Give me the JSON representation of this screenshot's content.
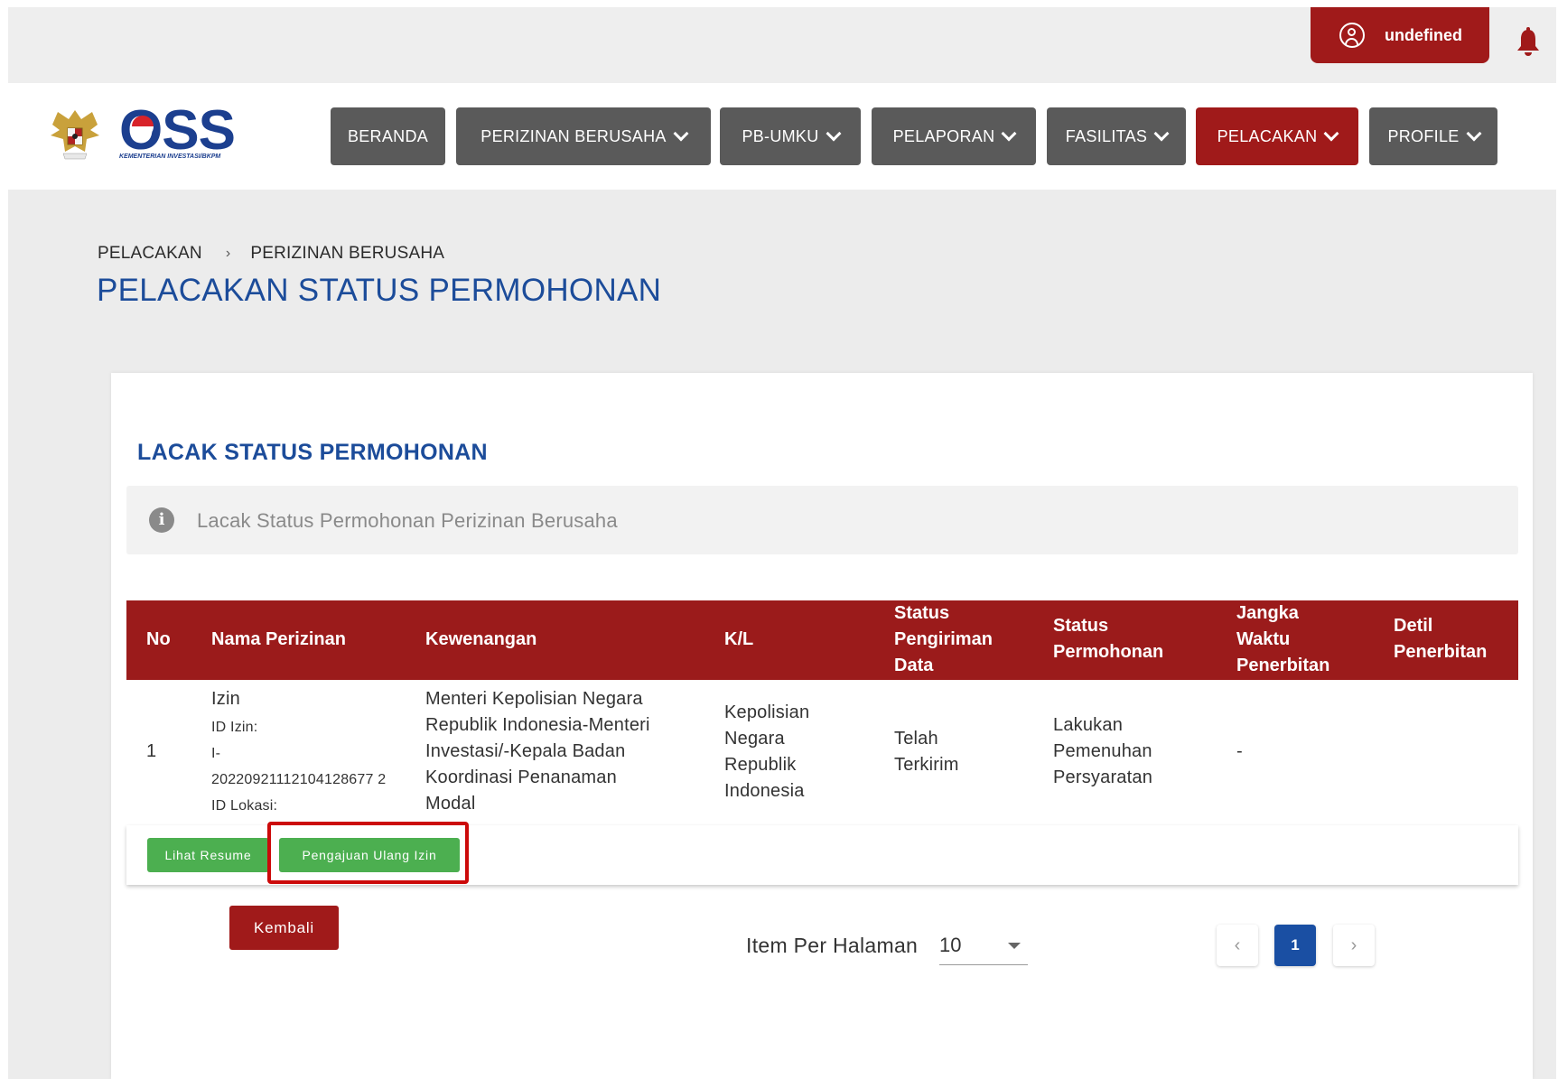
{
  "user": {
    "name": "undefined"
  },
  "brand": {
    "logo_text": "OSS",
    "logo_subtitle": "KEMENTERIAN INVESTASI/BKPM"
  },
  "nav": {
    "items": [
      {
        "label": "BERANDA",
        "dropdown": false,
        "active": false
      },
      {
        "label": "PERIZINAN BERUSAHA",
        "dropdown": true,
        "active": false
      },
      {
        "label": "PB-UMKU",
        "dropdown": true,
        "active": false
      },
      {
        "label": "PELAPORAN",
        "dropdown": true,
        "active": false
      },
      {
        "label": "FASILITAS",
        "dropdown": true,
        "active": false
      },
      {
        "label": "PELACAKAN",
        "dropdown": true,
        "active": true
      },
      {
        "label": "PROFILE",
        "dropdown": true,
        "active": false
      }
    ]
  },
  "breadcrumb": {
    "items": [
      "PELACAKAN",
      "PERIZINAN BERUSAHA"
    ],
    "separator": "›"
  },
  "page": {
    "title": "PELACAKAN STATUS PERMOHONAN"
  },
  "card": {
    "title": "LACAK STATUS PERMOHONAN",
    "info": {
      "icon": "info-icon",
      "text": "Lacak Status Permohonan Perizinan Berusaha"
    }
  },
  "table": {
    "headers": {
      "no": "No",
      "nama": "Nama Perizinan",
      "kewenangan": "Kewenangan",
      "kl": "K/L",
      "status_pengiriman": [
        "Status",
        "Pengiriman",
        "Data"
      ],
      "status_permohonan": [
        "Status",
        "Permohonan"
      ],
      "jangka_waktu": [
        "Jangka",
        "Waktu",
        "Penerbitan"
      ],
      "detil": [
        "Detil",
        "Penerbitan"
      ]
    },
    "rows": [
      {
        "no": "1",
        "nama": {
          "line1": "Izin",
          "line2": "ID Izin:",
          "line3": "I-",
          "line4": "20220921112104128677 2",
          "line5": "ID Lokasi:"
        },
        "kewenangan": [
          "Menteri Kepolisian Negara",
          "Republik Indonesia-Menteri",
          "Investasi/-Kepala Badan",
          "Koordinasi Penanaman",
          "Modal"
        ],
        "kl": [
          "Kepolisian",
          "Negara",
          "Republik",
          "Indonesia"
        ],
        "status_pengiriman": [
          "Telah",
          "Terkirim"
        ],
        "status_permohonan": [
          "Lakukan",
          "Pemenuhan",
          "Persyaratan"
        ],
        "jangka_waktu": "-",
        "detil": ""
      }
    ],
    "actions": {
      "resume": "Lihat Resume",
      "pengajuan": "Pengajuan Ulang Izin"
    }
  },
  "buttons": {
    "back": "Kembali"
  },
  "pagination": {
    "per_page_label": "Item Per Halaman",
    "per_page_value": "10",
    "current_page": "1",
    "prev": "‹",
    "next": "›"
  },
  "colors": {
    "primary_red": "#a01a1a",
    "nav_gray": "#5a5a5a",
    "brand_blue": "#1c4c9a",
    "green": "#4caf50",
    "highlight": "#cc0a0a"
  }
}
